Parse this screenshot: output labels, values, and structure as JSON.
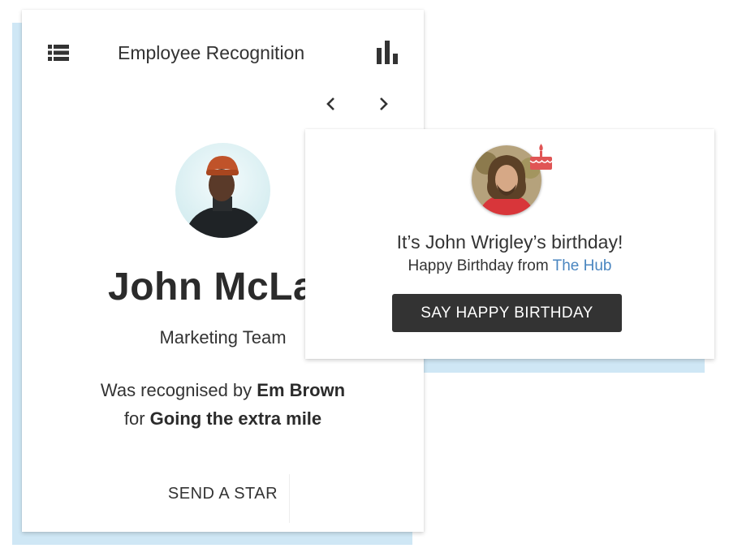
{
  "recognition_card": {
    "title": "Employee Recognition",
    "icons": {
      "menu": "list-menu-icon",
      "chart": "bar-chart-icon",
      "prev": "chevron-left-icon",
      "next": "chevron-right-icon"
    },
    "employee": {
      "name": "John McLa",
      "team": "Marketing Team"
    },
    "recognition": {
      "prefix": "Was recognised by",
      "recognised_by": "Em Brown",
      "for_prefix": "for",
      "reason": "Going the extra mile"
    },
    "send_star_label": "SEND A STAR"
  },
  "birthday_card": {
    "headline": "It’s John Wrigley’s birthday!",
    "greeting_prefix": "Happy Birthday from",
    "from_link": "The Hub",
    "button_label": "SAY HAPPY BIRTHDAY",
    "badge_icon": "birthday-cake-icon"
  },
  "colors": {
    "accent_shadow": "#cfe7f5",
    "link": "#4a86c0",
    "button_bg": "#333333",
    "cake": "#e05555"
  }
}
